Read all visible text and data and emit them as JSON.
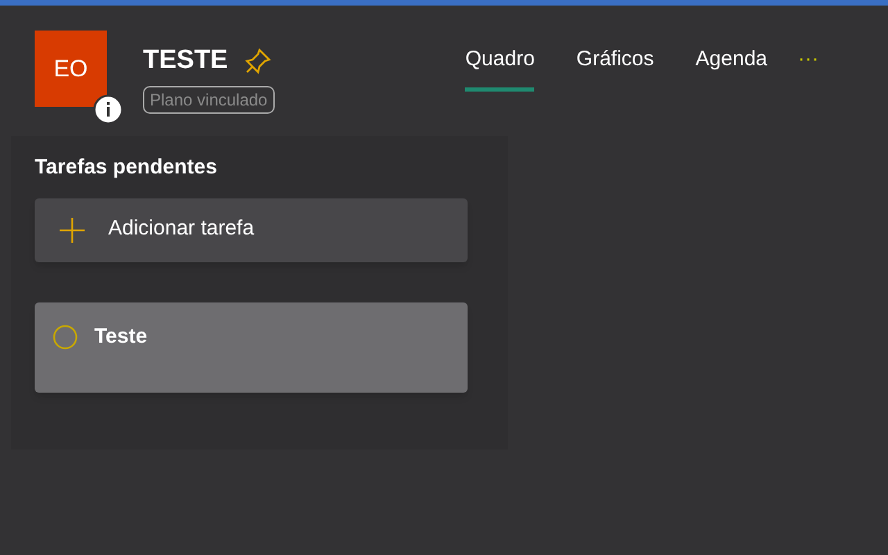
{
  "plan": {
    "initials": "EO",
    "title": "TESTE",
    "pinned": true,
    "badge": "Plano vinculado"
  },
  "tabs": [
    {
      "label": "Quadro",
      "selected": true
    },
    {
      "label": "Gráficos",
      "selected": false
    },
    {
      "label": "Agenda",
      "selected": false
    }
  ],
  "more": "···",
  "bucket": {
    "title": "Tarefas pendentes",
    "add_label": "Adicionar tarefa",
    "tasks": [
      {
        "title": "Teste",
        "completed": false
      }
    ]
  }
}
